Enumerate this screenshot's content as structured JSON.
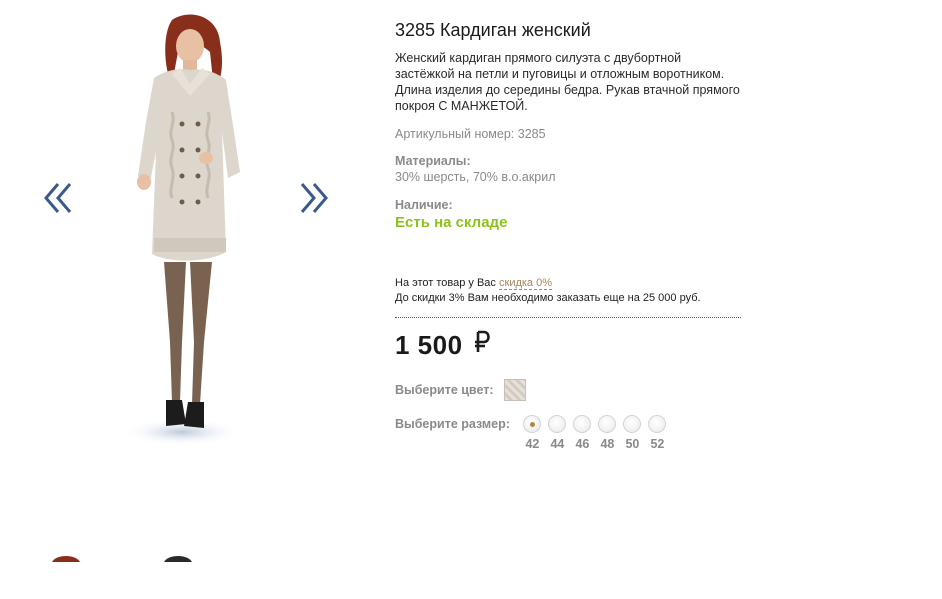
{
  "product": {
    "title": "3285 Кардиган женский",
    "description": "Женский кардиган прямого силуэта с двубортной застёжкой на петли и пуговицы и отложным воротником. Длина изделия до середины бедра. Рукав втачной прямого покроя С МАНЖЕТОЙ.",
    "article": "Артикульный номер: 3285",
    "materials_label": "Материалы:",
    "materials_value": "30% шерсть, 70% в.о.акрил",
    "availability_label": "Наличие:",
    "availability_value": "Есть на складе"
  },
  "discount": {
    "line1_prefix": "На этот товар у Вас",
    "line1_link": "скидка 0%",
    "line2": "До скидки 3% Вам необходимо заказать еще на 25 000 руб."
  },
  "price": {
    "value": "1 500",
    "currency_icon": "ruble-sign-icon"
  },
  "color": {
    "label": "Выберите цвет:",
    "swatch_icon": "beige-knit-swatch"
  },
  "size": {
    "label": "Выберите размер:",
    "selected": "42",
    "options": [
      "42",
      "44",
      "46",
      "48",
      "50",
      "52"
    ]
  },
  "gallery": {
    "prev_icon": "double-chevron-left-icon",
    "next_icon": "double-chevron-right-icon",
    "arrow_color": "#3a5a8c"
  },
  "colors": {
    "available": "#8cc21b",
    "link": "#a8865a",
    "selected_dot": "#b88440"
  }
}
